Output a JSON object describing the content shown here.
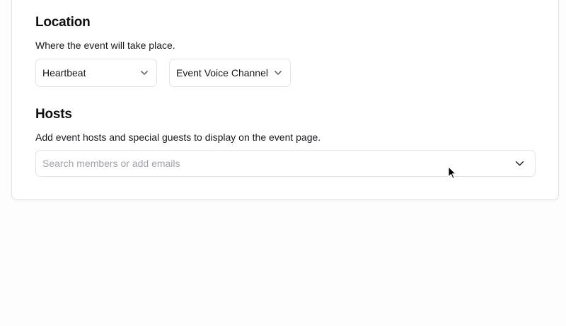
{
  "location": {
    "title": "Location",
    "description": "Where the event will take place.",
    "server_select": {
      "value": "Heartbeat",
      "icon": "chevron-down-icon"
    },
    "channel_select": {
      "value": "Event Voice Channel",
      "icon": "chevron-down-icon"
    }
  },
  "hosts": {
    "title": "Hosts",
    "description": "Add event hosts and special guests to display on the event page.",
    "search": {
      "value": "",
      "placeholder": "Search members or add emails",
      "icon": "chevron-down-icon"
    }
  },
  "cursor": {
    "icon": "mouse-pointer-icon"
  },
  "colors": {
    "border": "#e4e4e7",
    "text": "#18181b",
    "placeholder": "#a1a1aa",
    "chevron_muted": "#71717a"
  }
}
